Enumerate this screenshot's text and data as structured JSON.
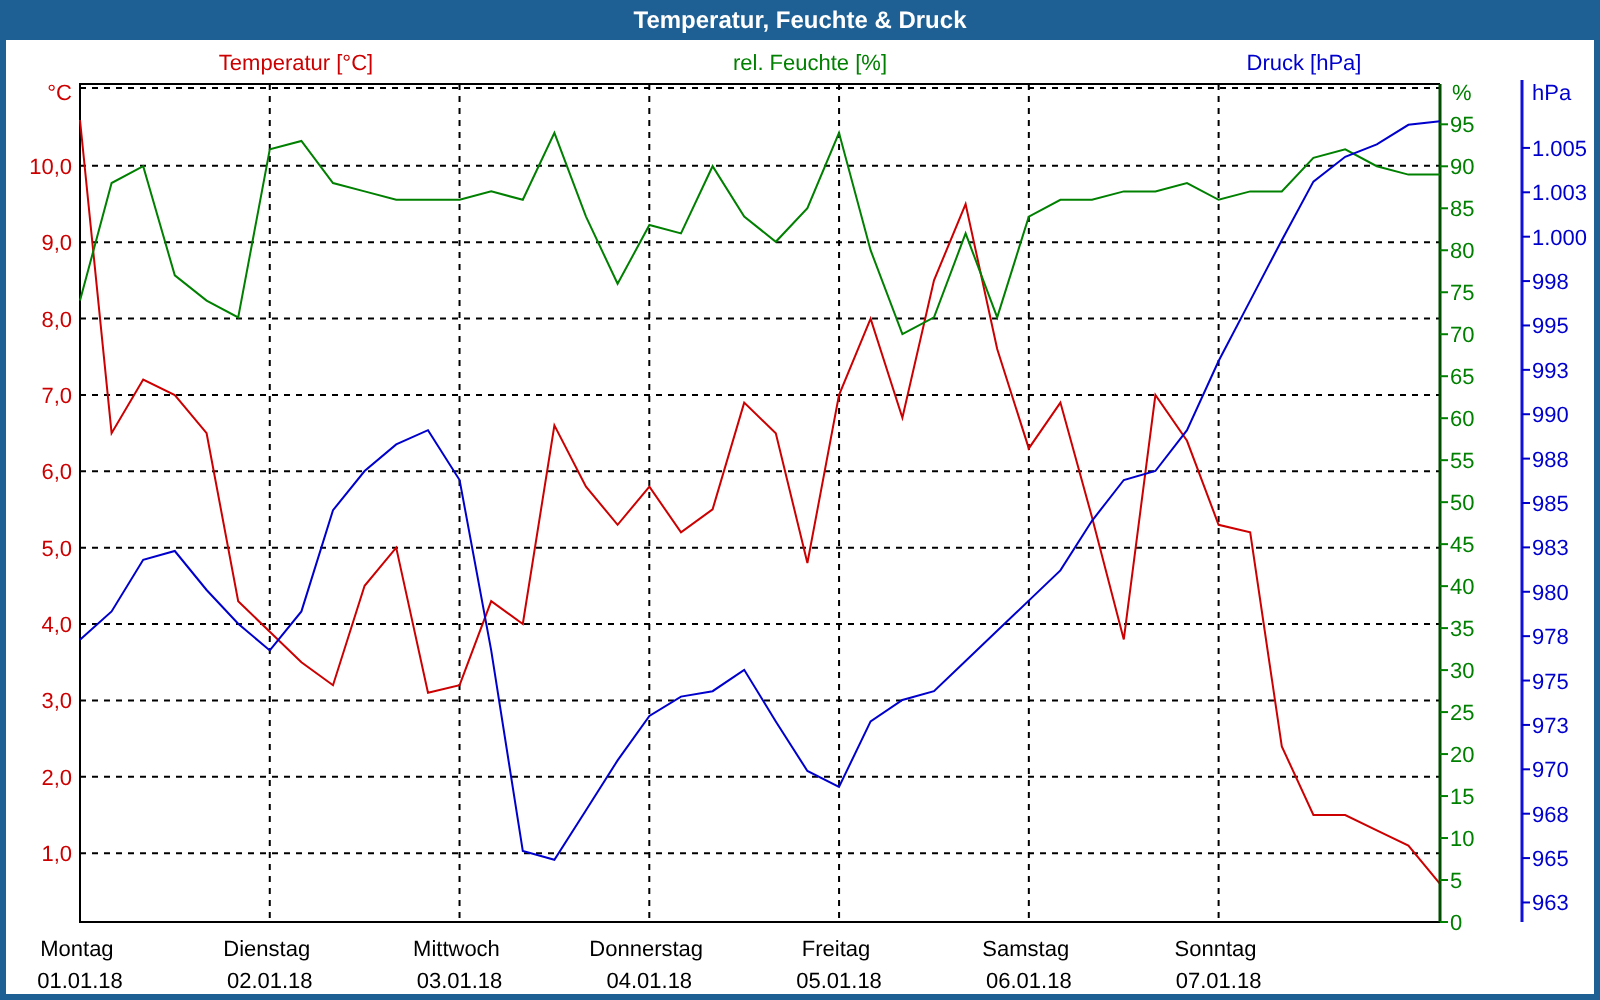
{
  "window": {
    "title": "Temperatur, Feuchte & Druck"
  },
  "charts": [
    {
      "chart_data": {
        "type": "line",
        "grid": true,
        "categories": [
          "Montag 01.01.18",
          null,
          null,
          null,
          null,
          null,
          "Dienstag 02.01.18",
          null,
          null,
          null,
          null,
          null,
          "Mittwoch 03.01.18",
          null,
          null,
          null,
          null,
          null,
          "Donnerstag 04.01.18",
          null,
          null,
          null,
          null,
          null,
          "Freitag 05.01.18",
          null,
          null,
          null,
          null,
          null,
          "Samstag 06.01.18",
          null,
          null,
          null,
          null,
          null,
          "Sonntag 07.01.18",
          null,
          null,
          null,
          null,
          null,
          null,
          null
        ],
        "ylabel": "°C",
        "ylim": [
          0.1,
          11.07
        ],
        "yticks": [
          {
            "value": 10,
            "label": "10,0"
          },
          {
            "value": 9,
            "label": "9,0"
          },
          {
            "value": 8,
            "label": "8,0"
          },
          {
            "value": 7,
            "label": "7,0"
          },
          {
            "value": 6,
            "label": "6,0"
          },
          {
            "value": 5,
            "label": "5,0"
          },
          {
            "value": 4,
            "label": "4,0"
          },
          {
            "value": 3,
            "label": "3,0"
          },
          {
            "value": 2,
            "label": "2,0"
          },
          {
            "value": 1,
            "label": "1,0"
          }
        ],
        "series": [
          {
            "name": "Temperatur [°C]",
            "color": "#cc0000",
            "values": [
              10.6,
              6.5,
              7.2,
              7.0,
              6.5,
              4.3,
              3.9,
              3.5,
              3.2,
              4.5,
              5.0,
              3.1,
              3.2,
              4.3,
              4.0,
              6.6,
              5.8,
              5.3,
              5.8,
              5.2,
              5.5,
              6.9,
              6.5,
              4.8,
              7.0,
              8.0,
              6.7,
              8.5,
              9.5,
              7.6,
              6.3,
              6.9,
              5.4,
              3.8,
              7.0,
              6.4,
              5.3,
              5.2,
              2.4,
              1.5,
              1.5,
              1.3,
              1.1,
              0.6
            ]
          }
        ]
      }
    },
    {
      "chart_data": {
        "type": "line",
        "ylabel": "%",
        "ylim": [
          0,
          99.8
        ],
        "yticks": [
          {
            "value": 95,
            "label": "95"
          },
          {
            "value": 90,
            "label": "90"
          },
          {
            "value": 85,
            "label": "85"
          },
          {
            "value": 80,
            "label": "80"
          },
          {
            "value": 75,
            "label": "75"
          },
          {
            "value": 70,
            "label": "70"
          },
          {
            "value": 65,
            "label": "65"
          },
          {
            "value": 60,
            "label": "60"
          },
          {
            "value": 55,
            "label": "55"
          },
          {
            "value": 50,
            "label": "50"
          },
          {
            "value": 45,
            "label": "45"
          },
          {
            "value": 40,
            "label": "40"
          },
          {
            "value": 35,
            "label": "35"
          },
          {
            "value": 30,
            "label": "30"
          },
          {
            "value": 25,
            "label": "25"
          },
          {
            "value": 20,
            "label": "20"
          },
          {
            "value": 15,
            "label": "15"
          },
          {
            "value": 10,
            "label": "10"
          },
          {
            "value": 5,
            "label": "5"
          },
          {
            "value": 0,
            "label": "0"
          }
        ],
        "series": [
          {
            "name": "rel. Feuchte [%]",
            "color": "#008000",
            "values": [
              74,
              88,
              90,
              77,
              74,
              72,
              92,
              93,
              88,
              87,
              86,
              86,
              86,
              87,
              86,
              94,
              84,
              76,
              83,
              82,
              90,
              84,
              81,
              85,
              94,
              80,
              70,
              72,
              82,
              72,
              84,
              86,
              86,
              87,
              87,
              88,
              86,
              87,
              87,
              91,
              92,
              90,
              89,
              89
            ]
          }
        ]
      }
    },
    {
      "chart_data": {
        "type": "line",
        "ylabel": "hPa",
        "ylim": [
          961.4,
          1008.6
        ],
        "yticks": [
          {
            "value": 1005,
            "label": "1.005"
          },
          {
            "value": 1002.5,
            "label": "1.003"
          },
          {
            "value": 1000,
            "label": "1.000"
          },
          {
            "value": 997.5,
            "label": "998"
          },
          {
            "value": 995,
            "label": "995"
          },
          {
            "value": 992.5,
            "label": "993"
          },
          {
            "value": 990,
            "label": "990"
          },
          {
            "value": 987.5,
            "label": "988"
          },
          {
            "value": 985,
            "label": "985"
          },
          {
            "value": 982.5,
            "label": "983"
          },
          {
            "value": 980,
            "label": "980"
          },
          {
            "value": 977.5,
            "label": "978"
          },
          {
            "value": 975,
            "label": "975"
          },
          {
            "value": 972.5,
            "label": "973"
          },
          {
            "value": 970,
            "label": "970"
          },
          {
            "value": 967.5,
            "label": "968"
          },
          {
            "value": 965,
            "label": "965"
          },
          {
            "value": 962.5,
            "label": "963"
          }
        ],
        "series": [
          {
            "name": "Druck [hPa]",
            "color": "#0000cc",
            "values": [
              977.3,
              978.9,
              981.8,
              982.3,
              980.1,
              978.2,
              976.7,
              978.9,
              984.6,
              986.8,
              988.3,
              989.1,
              986.3,
              976.7,
              965.4,
              964.9,
              967.7,
              970.5,
              973.0,
              974.1,
              974.4,
              975.6,
              972.7,
              969.9,
              969.0,
              972.7,
              973.9,
              974.4,
              976.1,
              977.8,
              979.5,
              981.2,
              984.0,
              986.3,
              986.8,
              989.1,
              993.0,
              996.4,
              999.8,
              1003.1,
              1004.5,
              1005.2,
              1006.3,
              1006.5
            ]
          }
        ]
      }
    }
  ]
}
